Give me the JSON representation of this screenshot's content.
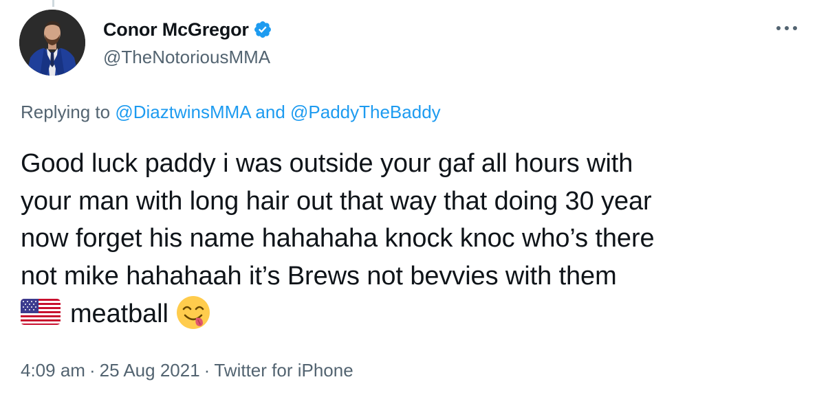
{
  "author": {
    "display_name": "Conor McGregor",
    "handle": "@TheNotoriousMMA",
    "verified": true,
    "avatar_icon": "profile-photo-man-in-blue-suit"
  },
  "reply_context": {
    "prefix": "Replying to ",
    "mentions": [
      "@DiaztwinsMMA",
      "@PaddyTheBaddy"
    ],
    "joiner": " and "
  },
  "tweet": {
    "lines": [
      "Good luck paddy i was outside your gaf all hours with",
      "your man with long hair out that way that doing 30 year",
      "now forget his name hahahaha knock knoc who’s there",
      "not mike hahahaah it’s Brews not bevvies with them"
    ],
    "last_line_text": "meatball",
    "flag_icon": "us-flag-emoji",
    "emoji_icon": "face-savoring-food-emoji"
  },
  "meta": {
    "time": "4:09 am",
    "date": "25 Aug 2021",
    "source": "Twitter for iPhone",
    "separator": "·"
  },
  "colors": {
    "text": "#0f1419",
    "secondary": "#536471",
    "link": "#1d9bf0",
    "verified": "#1d9bf0"
  }
}
